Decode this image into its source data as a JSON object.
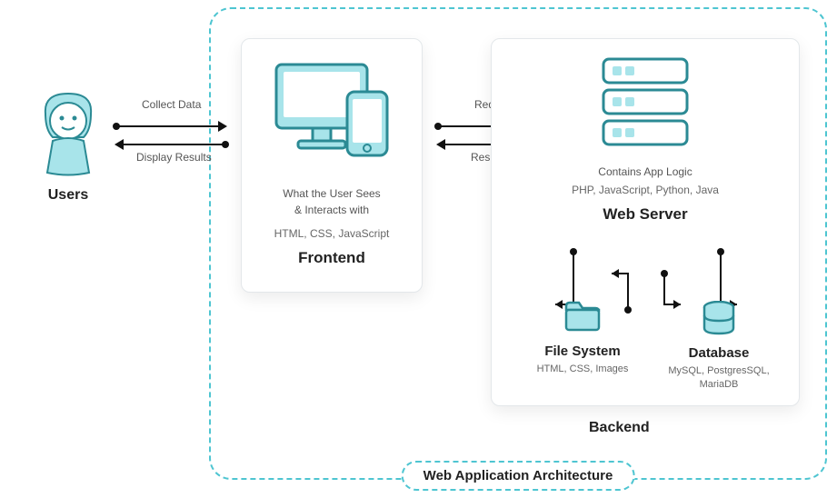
{
  "title": "Web Application Architecture",
  "users_label": "Users",
  "arrows1": {
    "top_label": "Collect Data",
    "bottom_label": "Display Results"
  },
  "arrows2": {
    "top_label": "Request",
    "bottom_label": "Response"
  },
  "frontend": {
    "desc1": "What the User Sees",
    "desc2": "& Interacts with",
    "tech": "HTML, CSS, JavaScript",
    "title": "Frontend"
  },
  "backend": {
    "label": "Backend",
    "server": {
      "desc": "Contains App Logic",
      "tech": "PHP, JavaScript, Python, Java",
      "title": "Web Server"
    },
    "filesystem": {
      "title": "File System",
      "tech": "HTML, CSS, Images"
    },
    "database": {
      "title": "Database",
      "tech": "MySQL, PostgresSQL, MariaDB"
    }
  }
}
